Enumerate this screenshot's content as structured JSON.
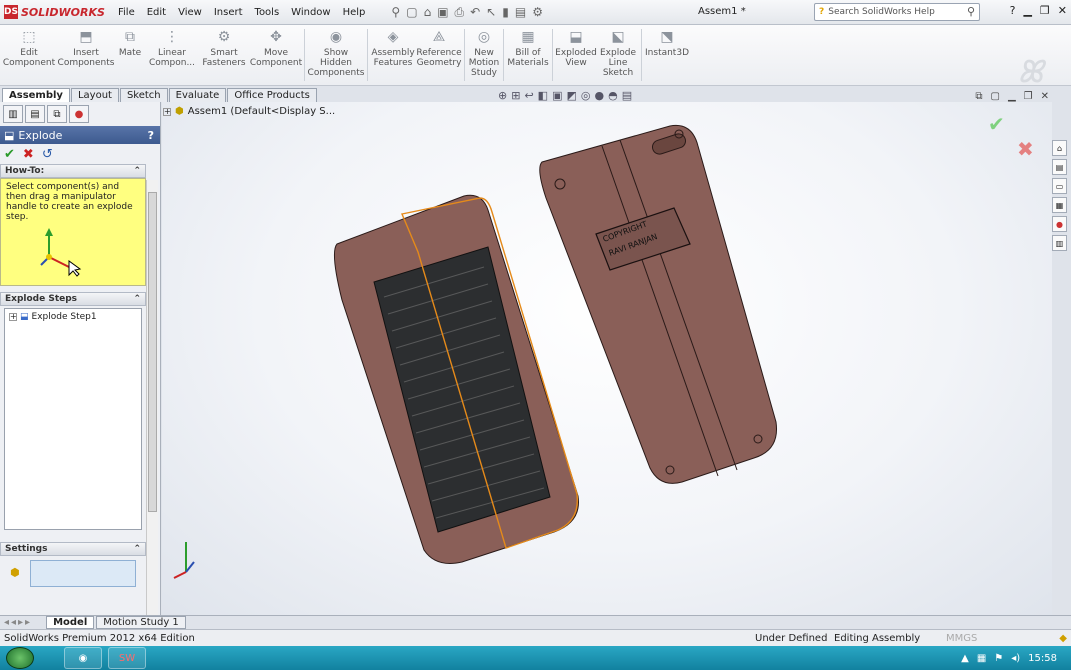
{
  "app": {
    "logo_text": "SOLIDWORKS",
    "ds_badge": "DS",
    "document_title": "Assem1 *"
  },
  "menu": {
    "items": [
      "File",
      "Edit",
      "View",
      "Insert",
      "Tools",
      "Window",
      "Help"
    ]
  },
  "search": {
    "placeholder": "Search SolidWorks Help"
  },
  "ribbon": {
    "buttons": [
      {
        "label": "Edit\nComponent",
        "icon": "edit-component-icon"
      },
      {
        "label": "Insert\nComponents",
        "icon": "insert-components-icon"
      },
      {
        "label": "Mate",
        "icon": "mate-icon"
      },
      {
        "label": "Linear\nCompon...",
        "icon": "linear-pattern-icon"
      },
      {
        "label": "Smart\nFasteners",
        "icon": "smart-fasteners-icon"
      },
      {
        "label": "Move\nComponent",
        "icon": "move-component-icon"
      },
      {
        "label": "Show\nHidden\nComponents",
        "icon": "show-hidden-icon"
      },
      {
        "label": "Assembly\nFeatures",
        "icon": "assembly-features-icon"
      },
      {
        "label": "Reference\nGeometry",
        "icon": "reference-geometry-icon"
      },
      {
        "label": "New\nMotion\nStudy",
        "icon": "motion-study-icon"
      },
      {
        "label": "Bill of\nMaterials",
        "icon": "bill-of-materials-icon"
      },
      {
        "label": "Exploded\nView",
        "icon": "exploded-view-icon"
      },
      {
        "label": "Explode\nLine\nSketch",
        "icon": "explode-line-sketch-icon"
      },
      {
        "label": "Instant3D",
        "icon": "instant3d-icon"
      }
    ]
  },
  "command_tabs": [
    "Assembly",
    "Layout",
    "Sketch",
    "Evaluate",
    "Office Products"
  ],
  "property_manager": {
    "title": "Explode",
    "help_glyph": "?",
    "howto_title": "How-To:",
    "howto_text": "Select component(s) and then drag a manipulator handle to create an explode step.",
    "steps_title": "Explode Steps",
    "step_item": "Explode Step1",
    "settings_title": "Settings"
  },
  "tree": {
    "root_label": "Assem1  (Default<Display S..."
  },
  "model": {
    "copyright_line1": "COPYRIGHT",
    "copyright_line2": "RAVI RANJAN"
  },
  "bottom_tabs": [
    "Model",
    "Motion Study 1"
  ],
  "status": {
    "edition": "SolidWorks Premium 2012 x64 Edition",
    "state1": "Under Defined",
    "state2": "Editing Assembly",
    "units": "MMGS"
  },
  "taskbar": {
    "clock": "15:58"
  }
}
